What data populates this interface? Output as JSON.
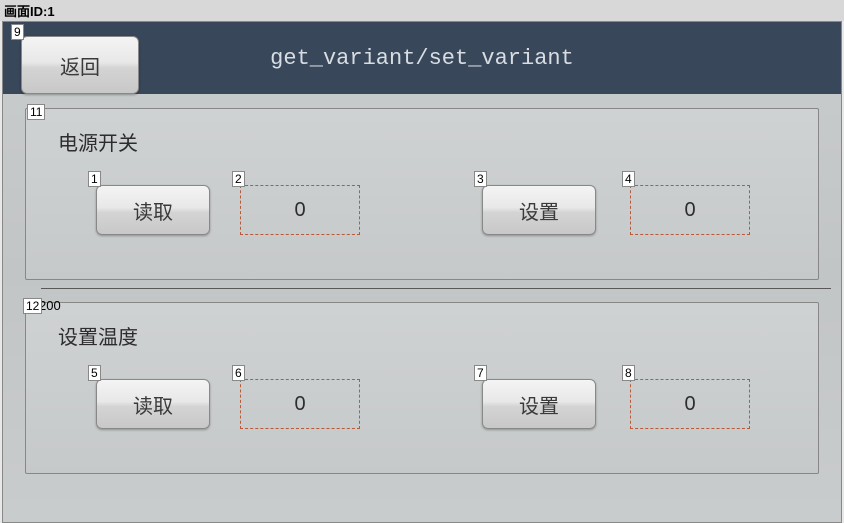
{
  "topbar": {
    "text": "画面ID:1"
  },
  "header": {
    "back_label": "返回",
    "title": "get_variant/set_variant"
  },
  "tags": {
    "back": "9",
    "panel1": "11",
    "panel2": "12",
    "panel2_extra": "200",
    "p1_read_btn": "1",
    "p1_read_val": "2",
    "p1_set_btn": "3",
    "p1_set_val": "4",
    "p2_read_btn": "5",
    "p2_read_val": "6",
    "p2_set_btn": "7",
    "p2_set_val": "8"
  },
  "panel1": {
    "label": "电源开关",
    "read_btn": "读取",
    "read_val": "0",
    "set_btn": "设置",
    "set_val": "0"
  },
  "panel2": {
    "label": "设置温度",
    "read_btn": "读取",
    "read_val": "0",
    "set_btn": "设置",
    "set_val": "0"
  }
}
